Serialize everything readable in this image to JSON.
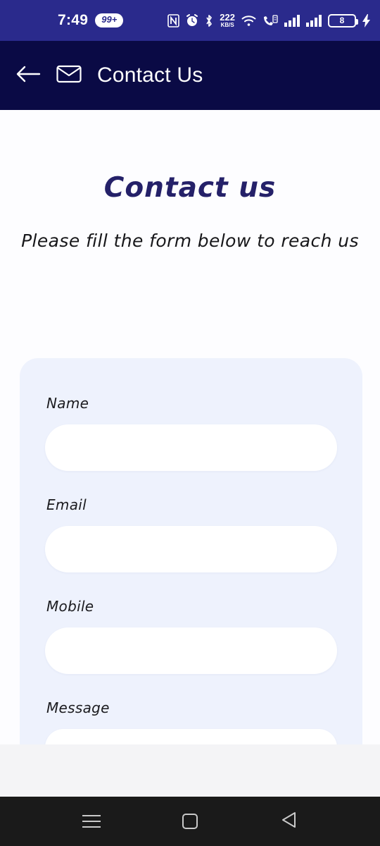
{
  "status_bar": {
    "time": "7:49",
    "notification_badge": "99+",
    "data_speed_value": "222",
    "data_speed_unit": "KB/S",
    "battery_level": "8",
    "icons": [
      "nfc-icon",
      "alarm-icon",
      "bluetooth-icon",
      "data-speed-indicator",
      "wifi-icon",
      "call-signal-icon",
      "signal-bars-sim1-icon",
      "signal-bars-sim2-icon",
      "battery-icon",
      "charging-bolt-icon"
    ],
    "background_color": "#2a2a8c",
    "foreground_color": "#ffffff"
  },
  "app_bar": {
    "back_label": "Back",
    "title": "Contact Us",
    "mail_icon": "envelope-icon",
    "background_color": "#0a0a45",
    "text_color": "#ffffff"
  },
  "page": {
    "heading": "Contact us",
    "subheading": "Please fill the form below to reach us",
    "heading_color": "#252169",
    "background_color": "#fdfdff",
    "card_color": "#eef2fd"
  },
  "form": {
    "fields": [
      {
        "label": "Name",
        "value": "",
        "placeholder": "",
        "type": "text"
      },
      {
        "label": "Email",
        "value": "",
        "placeholder": "",
        "type": "email"
      },
      {
        "label": "Mobile",
        "value": "",
        "placeholder": "",
        "type": "tel"
      },
      {
        "label": "Message",
        "value": "",
        "placeholder": "",
        "type": "textarea"
      }
    ]
  },
  "nav_bar": {
    "recents_label": "Recents",
    "home_label": "Home",
    "back_label": "Back",
    "background_color": "#1a1a1a",
    "icon_color": "#c9c9c9"
  }
}
